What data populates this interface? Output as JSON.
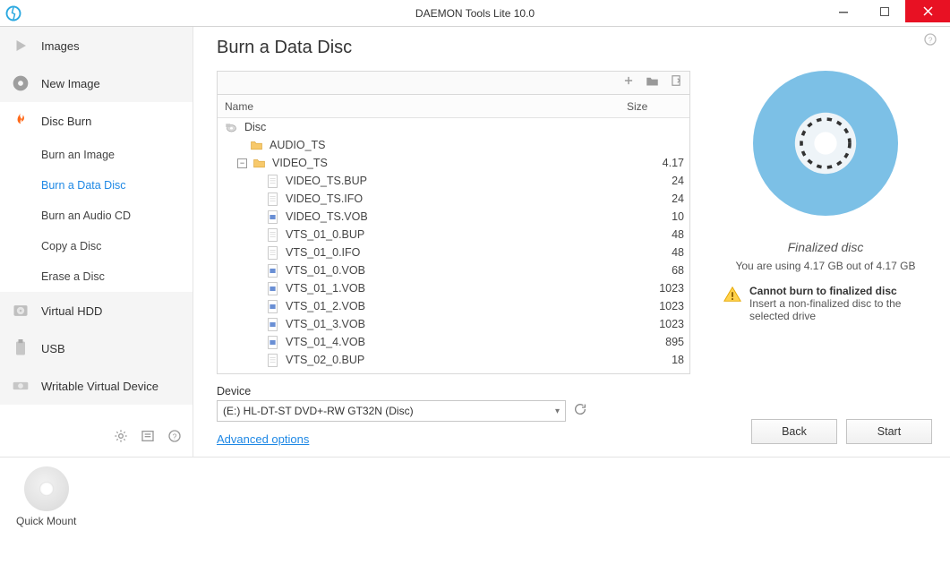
{
  "window": {
    "title": "DAEMON Tools Lite 10.0"
  },
  "sidebar": {
    "items": [
      {
        "label": "Images"
      },
      {
        "label": "New Image"
      },
      {
        "label": "Disc Burn"
      },
      {
        "label": "Virtual HDD"
      },
      {
        "label": "USB"
      },
      {
        "label": "Writable Virtual Device"
      }
    ],
    "sub": [
      {
        "label": "Burn an Image"
      },
      {
        "label": "Burn a Data Disc"
      },
      {
        "label": "Burn an Audio CD"
      },
      {
        "label": "Copy a Disc"
      },
      {
        "label": "Erase a Disc"
      }
    ]
  },
  "page": {
    "title": "Burn a Data Disc",
    "columns": {
      "name": "Name",
      "size": "Size"
    },
    "root": "Disc",
    "folder1": "AUDIO_TS",
    "folder2": "VIDEO_TS",
    "folder2_size": "4.17",
    "files": [
      {
        "name": "VIDEO_TS.BUP",
        "size": "24",
        "type": "doc"
      },
      {
        "name": "VIDEO_TS.IFO",
        "size": "24",
        "type": "doc"
      },
      {
        "name": "VIDEO_TS.VOB",
        "size": "10",
        "type": "vob"
      },
      {
        "name": "VTS_01_0.BUP",
        "size": "48",
        "type": "doc"
      },
      {
        "name": "VTS_01_0.IFO",
        "size": "48",
        "type": "doc"
      },
      {
        "name": "VTS_01_0.VOB",
        "size": "68",
        "type": "vob"
      },
      {
        "name": "VTS_01_1.VOB",
        "size": "1023",
        "type": "vob"
      },
      {
        "name": "VTS_01_2.VOB",
        "size": "1023",
        "type": "vob"
      },
      {
        "name": "VTS_01_3.VOB",
        "size": "1023",
        "type": "vob"
      },
      {
        "name": "VTS_01_4.VOB",
        "size": "895",
        "type": "vob"
      },
      {
        "name": "VTS_02_0.BUP",
        "size": "18",
        "type": "doc"
      }
    ],
    "device_label": "Device",
    "device_value": "(E:) HL-DT-ST DVD+-RW GT32N (Disc)",
    "advanced": "Advanced options"
  },
  "status": {
    "title": "Finalized disc",
    "usage": "You are using 4.17 GB out of 4.17 GB",
    "warn_title": "Cannot burn to finalized disc",
    "warn_body": "Insert a non-finalized disc to the selected drive"
  },
  "actions": {
    "back": "Back",
    "start": "Start"
  },
  "quickmount": "Quick Mount"
}
